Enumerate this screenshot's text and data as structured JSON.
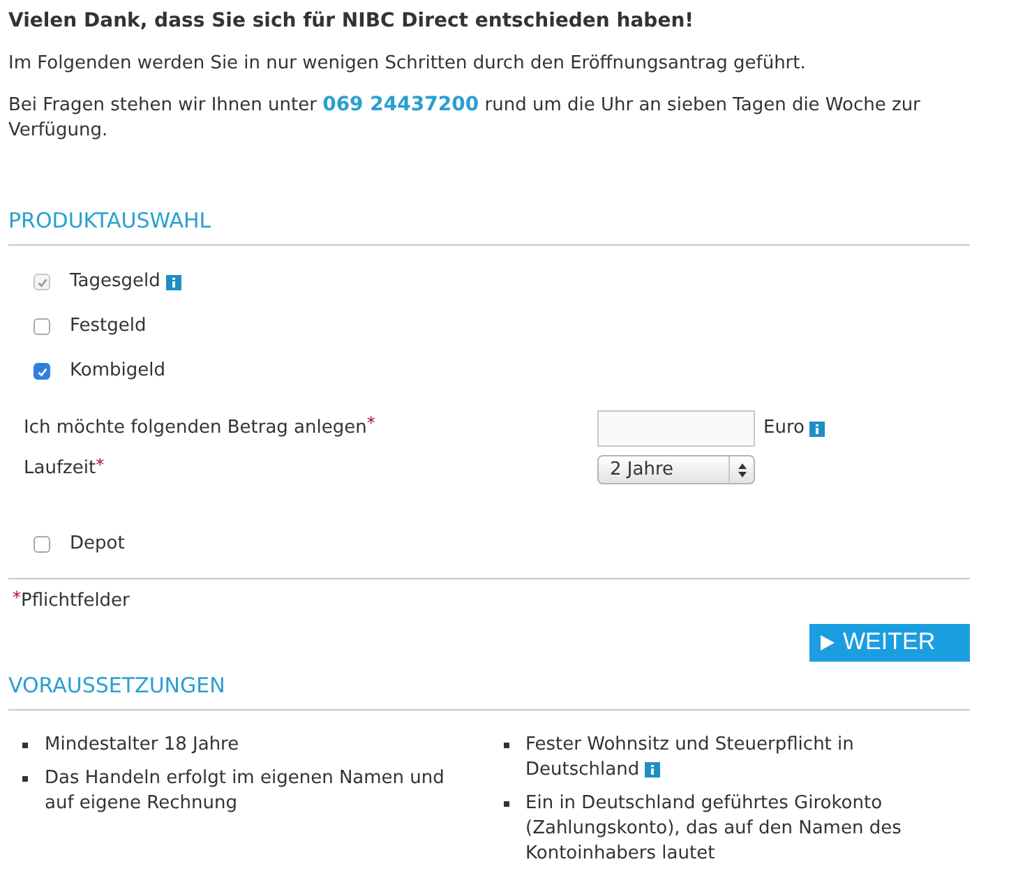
{
  "intro": {
    "title": "Vielen Dank, dass Sie sich für NIBC Direct entschieden haben!",
    "line": "Im Folgenden werden Sie in nur wenigen Schritten durch den Eröffnungsantrag geführt.",
    "contact_before": "Bei Fragen stehen wir Ihnen unter",
    "phone": "069 24437200",
    "contact_after": "rund um die Uhr an sieben Tagen die Woche zur Verfügung."
  },
  "product_section": {
    "heading": "PRODUKTAUSWAHL",
    "products": [
      {
        "label": "Tagesgeld",
        "checked": true,
        "disabled": true,
        "info": true
      },
      {
        "label": "Festgeld",
        "checked": false,
        "disabled": false,
        "info": false
      },
      {
        "label": "Kombigeld",
        "checked": true,
        "disabled": false,
        "info": false
      }
    ],
    "amount": {
      "label": "Ich möchte folgenden Betrag anlegen",
      "mark": "*",
      "unit": "Euro",
      "info": true
    },
    "term": {
      "label": "Laufzeit",
      "mark": "*",
      "value": "2 Jahre"
    },
    "depot": {
      "label": "Depot",
      "checked": false,
      "disabled": false
    },
    "note": {
      "mark": "*",
      "text": "Pflichtfelder"
    },
    "button": "WEITER"
  },
  "requirements": {
    "heading": "VORAUSSETZUNGEN",
    "columns": [
      [
        {
          "text": "Mindestalter 18 Jahre",
          "info": false
        },
        {
          "text": "Das Handeln erfolgt im eigenen Namen und auf eigene Rechnung",
          "info": false
        }
      ],
      [
        {
          "text": "Fester Wohnsitz und Steuerpflicht in Deutschland",
          "info": true
        },
        {
          "text": "Ein in Deutschland geführtes Girokonto (Zahlungskonto), das auf den Namen des Kontoinhabers lautet",
          "info": false
        }
      ]
    ]
  }
}
